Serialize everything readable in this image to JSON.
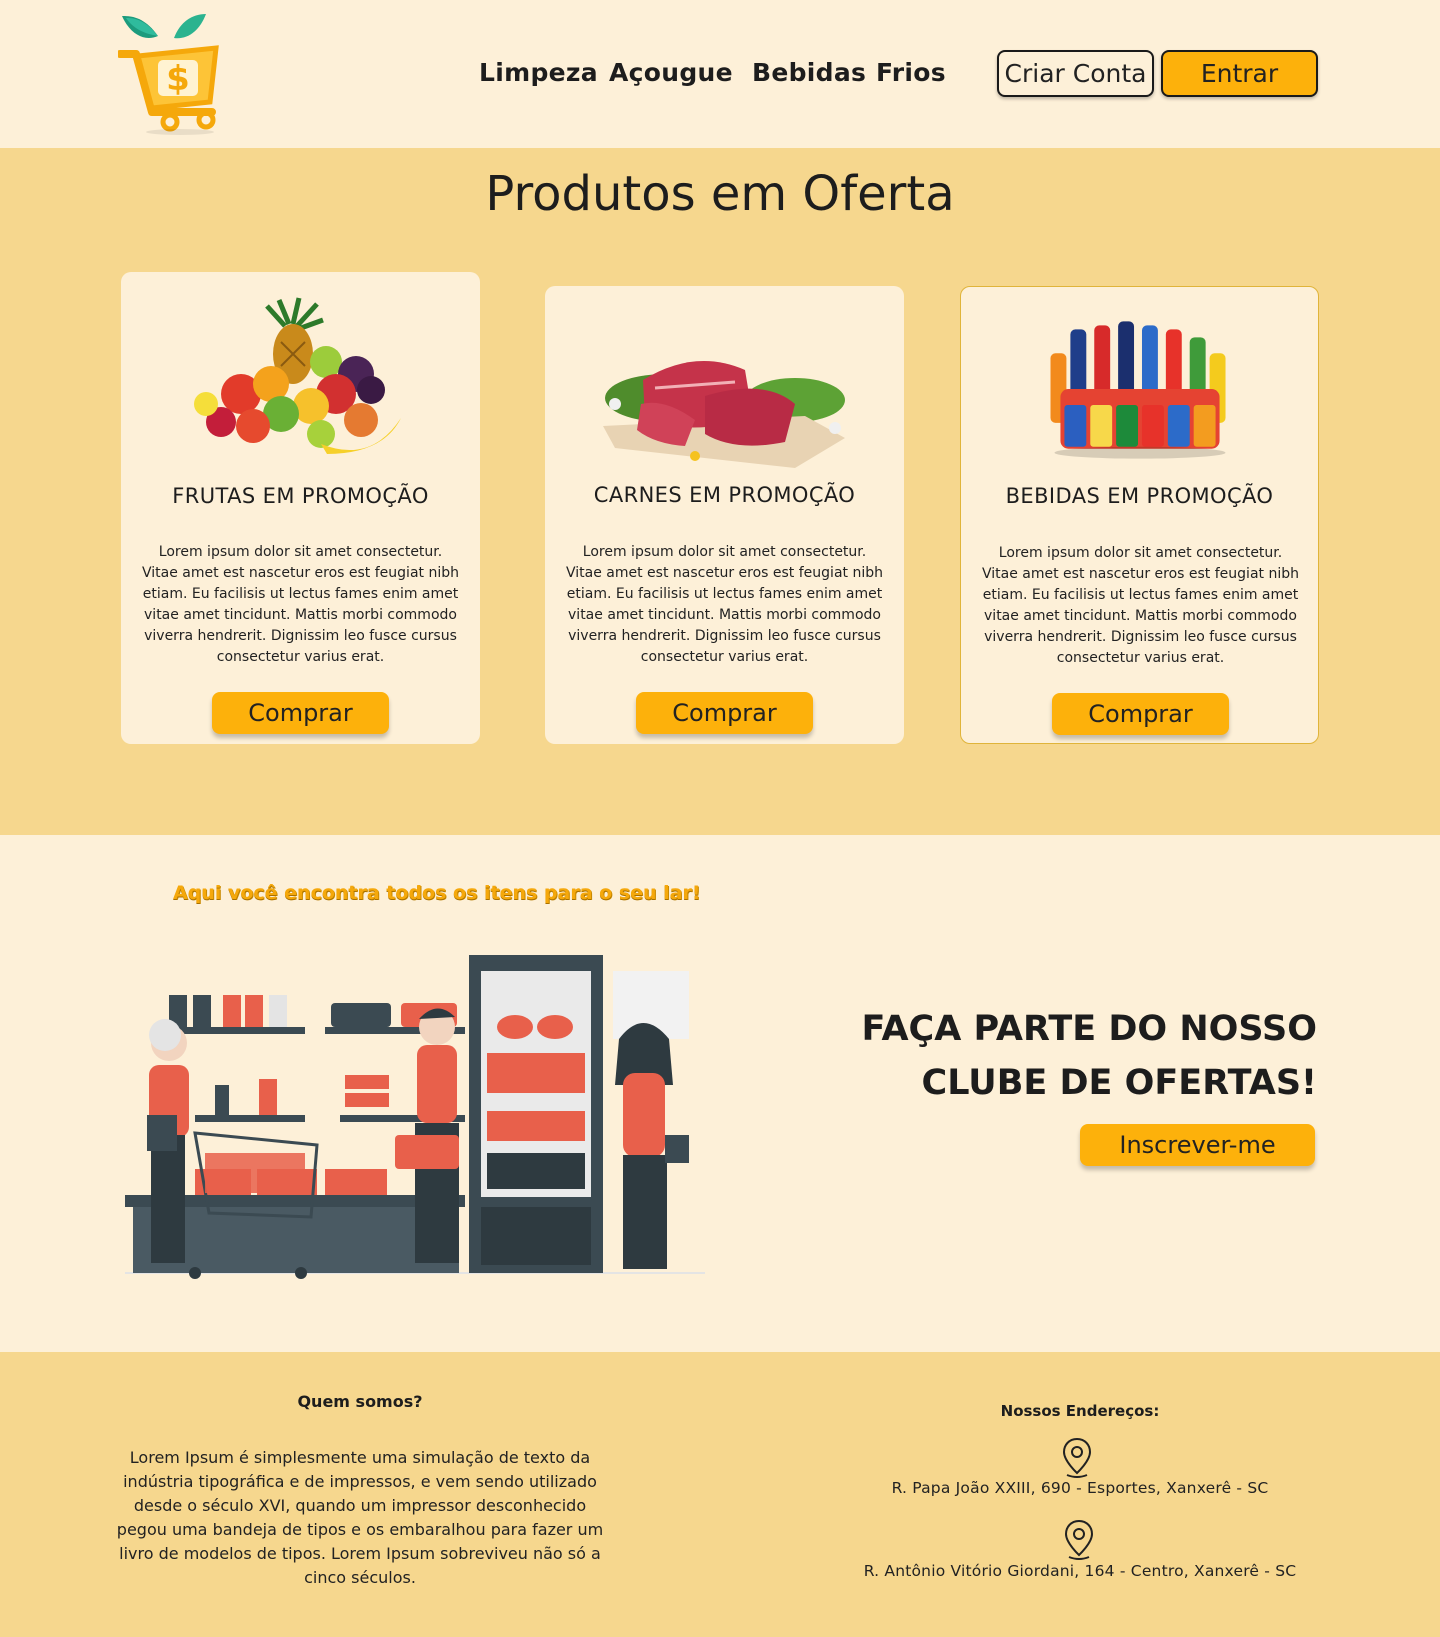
{
  "header": {
    "nav": [
      "Limpeza",
      "Açougue",
      "Bebidas",
      "Frios"
    ],
    "create_account": "Criar Conta",
    "login": "Entrar"
  },
  "offers": {
    "title": "Produtos em Oferta",
    "cards": [
      {
        "title": "FRUTAS EM PROMOÇÃO",
        "text": "Lorem ipsum dolor sit amet consectetur. Vitae amet est nascetur eros est feugiat nibh etiam. Eu facilisis ut lectus fames enim amet vitae amet tincidunt. Mattis morbi commodo viverra hendrerit. Dignissim leo fusce cursus consectetur varius erat.",
        "button": "Comprar"
      },
      {
        "title": "CARNES EM PROMOÇÃO",
        "text": "Lorem ipsum dolor sit amet consectetur. Vitae amet est nascetur eros est feugiat nibh etiam. Eu facilisis ut lectus fames enim amet vitae amet tincidunt. Mattis morbi commodo viverra hendrerit. Dignissim leo fusce cursus consectetur varius erat.",
        "button": "Comprar"
      },
      {
        "title": "BEBIDAS EM PROMOÇÃO",
        "text": "Lorem ipsum dolor sit amet consectetur. Vitae amet est nascetur eros est feugiat nibh etiam. Eu facilisis ut lectus fames enim amet vitae amet tincidunt. Mattis morbi commodo viverra hendrerit. Dignissim leo fusce cursus consectetur varius erat.",
        "button": "Comprar"
      }
    ]
  },
  "club": {
    "tagline": "Aqui você encontra todos os itens para o seu lar!",
    "heading_line1": "FAÇA PARTE DO NOSSO",
    "heading_line2": "CLUBE DE OFERTAS!",
    "subscribe": "Inscrever-me"
  },
  "footer": {
    "about_title": "Quem somos?",
    "about_text": "Lorem Ipsum é simplesmente uma simulação de texto da indústria tipográfica e de impressos, e vem sendo utilizado desde o século XVI, quando um impressor desconhecido pegou uma bandeja de tipos e os embaralhou para fazer um livro de modelos de tipos. Lorem Ipsum sobreviveu não só a cinco séculos.",
    "addresses_title": "Nossos Endereços:",
    "addresses": [
      "R. Papa João XXIII, 690 - Esportes, Xanxerê - SC",
      "R. Antônio Vitório Giordani, 164 - Centro, Xanxerê - SC"
    ]
  },
  "colors": {
    "cream": "#fdf0d8",
    "sand": "#f6d78e",
    "accent": "#fdb10b"
  }
}
